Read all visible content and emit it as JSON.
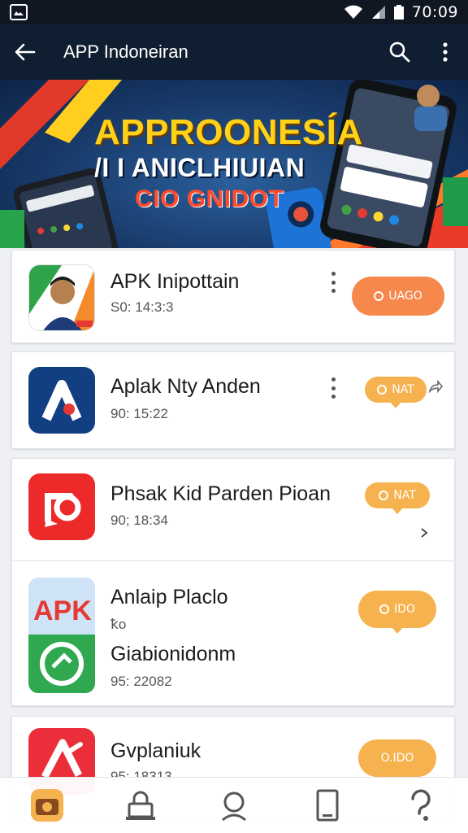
{
  "status_bar": {
    "time": "70:09"
  },
  "app_bar": {
    "title": "APP Indoneiran"
  },
  "banner": {
    "line1": "APPROONESÍA",
    "line2": "/I I  ANICLHIUIAN",
    "line3": "CIO GNIDOT"
  },
  "apps": [
    {
      "name": "APK Inipottain",
      "meta": "S0: 14:3:3",
      "button": "UAGO"
    },
    {
      "name": "Aplak Nty Anden",
      "meta": "90: 15:22",
      "button": "NAT"
    },
    {
      "name": "Phsak Kid Parden Pioan",
      "meta": "90; 18:34",
      "button": "NAT"
    },
    {
      "name": "Anlaip Placlo",
      "sub": "ꝁo",
      "name2": "Giabionidonm",
      "meta": "95: 22082",
      "button": "IDO"
    },
    {
      "name": "Gvplaniuk",
      "meta": "95: 18313",
      "button": "O.IDO"
    }
  ],
  "icons": {
    "back": "arrow-left-icon",
    "search": "search-icon",
    "more": "more-vert-icon",
    "nav": [
      "camera-icon",
      "lock-icon",
      "profile-icon",
      "phone-icon",
      "help-icon"
    ]
  },
  "colors": {
    "appbar": "#0f1e30",
    "orange": "#f5884a",
    "amber": "#f6b24e",
    "banner": "#183a6a"
  }
}
